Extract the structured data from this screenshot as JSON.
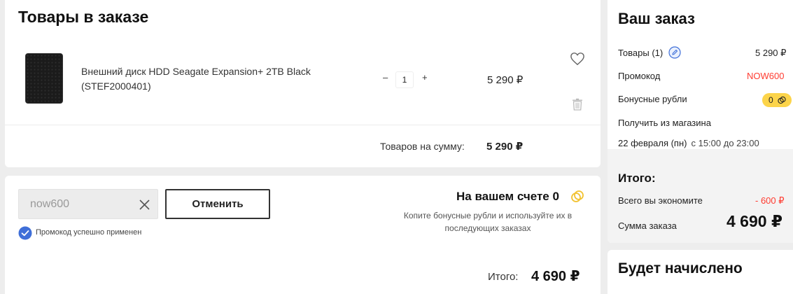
{
  "items_section": {
    "title": "Товары в заказе",
    "product": {
      "name": "Внешний диск HDD Seagate Expansion+ 2TB Black (STEF2000401)",
      "quantity": "1",
      "minus": "–",
      "plus": "+",
      "price": "5 290 ₽",
      "image_icon": "hdd-image",
      "favorite_icon": "heart-icon",
      "delete_icon": "trash-icon"
    },
    "subtotal_label": "Товаров на сумму:",
    "subtotal_value": "5 290 ₽"
  },
  "promo_section": {
    "promo_input_value": "now600",
    "clear_icon": "close-icon",
    "cancel_button": "Отменить",
    "success_message": "Промокод успешно применен",
    "account_title": "На вашем счете 0",
    "account_hint": "Копите бонусные рубли и используйте их в последующих заказах",
    "total_label": "Итого:",
    "total_value": "4 690 ₽"
  },
  "order_summary": {
    "title": "Ваш заказ",
    "goods_label": "Товары (1)",
    "goods_value": "5 290 ₽",
    "promo_label": "Промокод",
    "promo_value": "NOW600",
    "bonus_label": "Бонусные рубли",
    "bonus_value": "0",
    "pickup_label": "Получить из магазина",
    "pickup_date": "22 февраля (пн)",
    "pickup_time": "с 15:00 до 23:00",
    "total_heading": "Итого:",
    "savings_label": "Всего вы экономите",
    "savings_value": "- 600 ₽",
    "order_sum_label": "Сумма заказа",
    "order_sum_value": "4 690 ₽"
  },
  "bonus_section": {
    "title": "Будет начислено"
  },
  "colors": {
    "accent_red": "#ff3b30",
    "bonus_yellow": "#fcd44a",
    "check_blue": "#3f6fd8"
  }
}
